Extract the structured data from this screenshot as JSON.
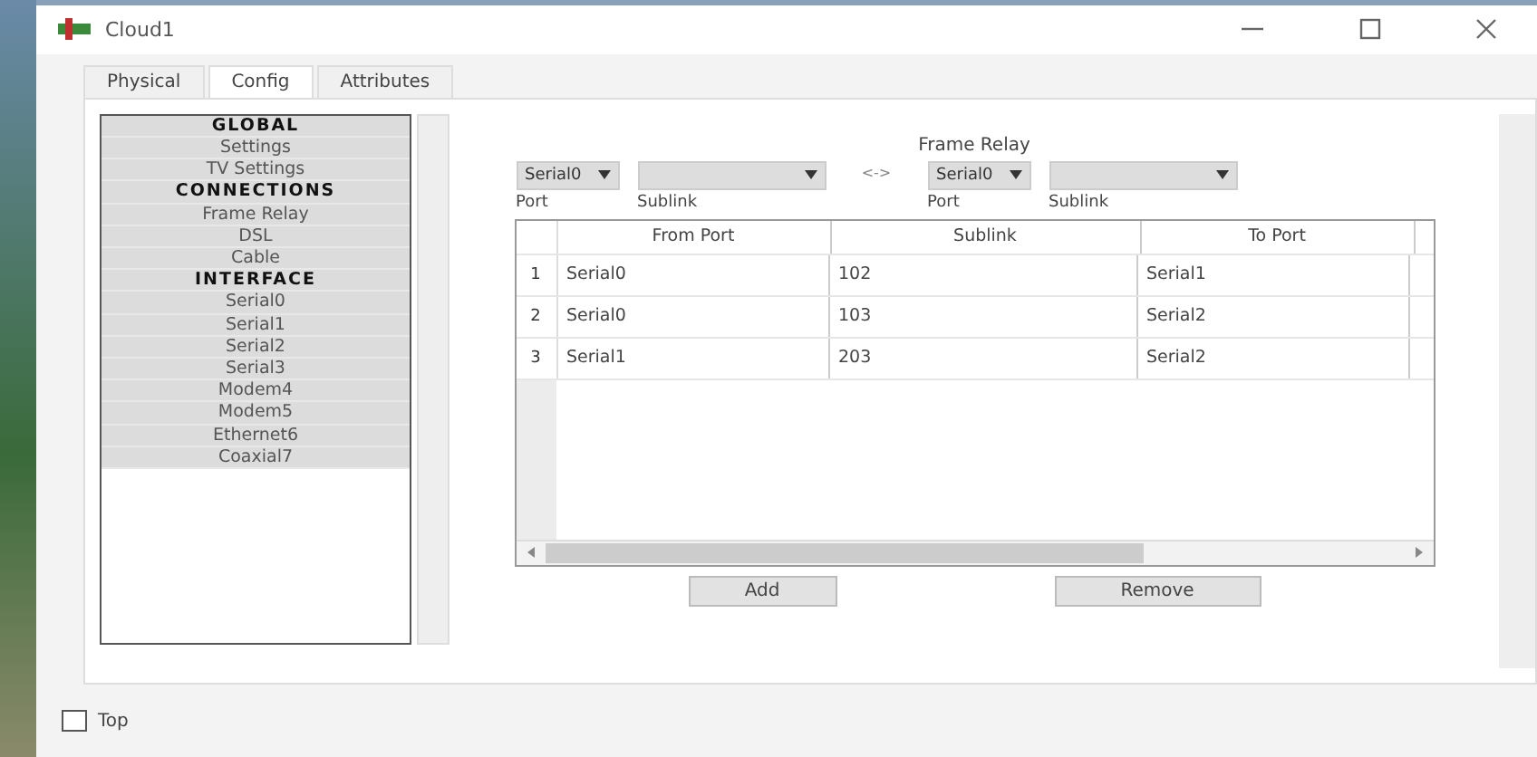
{
  "window": {
    "title": "Cloud1"
  },
  "tabs": [
    {
      "label": "Physical",
      "selected": false
    },
    {
      "label": "Config",
      "selected": true
    },
    {
      "label": "Attributes",
      "selected": false
    }
  ],
  "sidebar": {
    "items": [
      {
        "label": "GLOBAL",
        "kind": "header"
      },
      {
        "label": "Settings",
        "kind": "item"
      },
      {
        "label": "TV Settings",
        "kind": "item"
      },
      {
        "label": "CONNECTIONS",
        "kind": "header"
      },
      {
        "label": "Frame Relay",
        "kind": "item"
      },
      {
        "label": "DSL",
        "kind": "item"
      },
      {
        "label": "Cable",
        "kind": "item"
      },
      {
        "label": "INTERFACE",
        "kind": "header"
      },
      {
        "label": "Serial0",
        "kind": "item"
      },
      {
        "label": "Serial1",
        "kind": "item"
      },
      {
        "label": "Serial2",
        "kind": "item"
      },
      {
        "label": "Serial3",
        "kind": "item"
      },
      {
        "label": "Modem4",
        "kind": "item"
      },
      {
        "label": "Modem5",
        "kind": "item"
      },
      {
        "label": "Ethernet6",
        "kind": "item"
      },
      {
        "label": "Coaxial7",
        "kind": "item"
      }
    ]
  },
  "panel": {
    "title": "Frame Relay",
    "from_port": {
      "value": "Serial0",
      "label": "Port"
    },
    "from_sublink": {
      "label": "Sublink"
    },
    "link_symbol": "<->",
    "to_port": {
      "value": "Serial0",
      "label": "Port"
    },
    "to_sublink": {
      "label": "Sublink"
    },
    "table": {
      "columns": [
        "From Port",
        "Sublink",
        "To Port"
      ],
      "rows": [
        {
          "index": "1",
          "cells": [
            "Serial0",
            "102",
            "Serial1"
          ]
        },
        {
          "index": "2",
          "cells": [
            "Serial0",
            "103",
            "Serial2"
          ]
        },
        {
          "index": "3",
          "cells": [
            "Serial1",
            "203",
            "Serial2"
          ]
        }
      ]
    },
    "buttons": [
      "Add",
      "Remove"
    ]
  },
  "footer": {
    "checkbox": {
      "label": "Top",
      "checked": false
    }
  }
}
